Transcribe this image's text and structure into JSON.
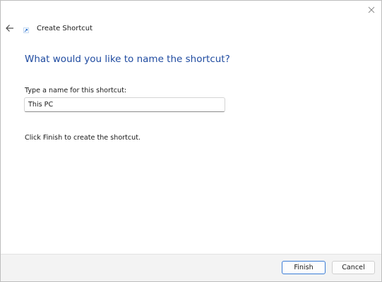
{
  "window": {
    "title": "Create Shortcut",
    "icons": {
      "close": "close-icon",
      "back": "back-arrow-icon",
      "app": "shortcut-app-icon"
    }
  },
  "page": {
    "heading": "What would you like to name the shortcut?",
    "field_label": "Type a name for this shortcut:",
    "name_value": "This PC",
    "instruction": "Click Finish to create the shortcut."
  },
  "footer": {
    "finish_label": "Finish",
    "cancel_label": "Cancel"
  },
  "colors": {
    "heading": "#1f4ba0",
    "accent": "#3a7bd5",
    "footer_bg": "#f3f3f3"
  }
}
